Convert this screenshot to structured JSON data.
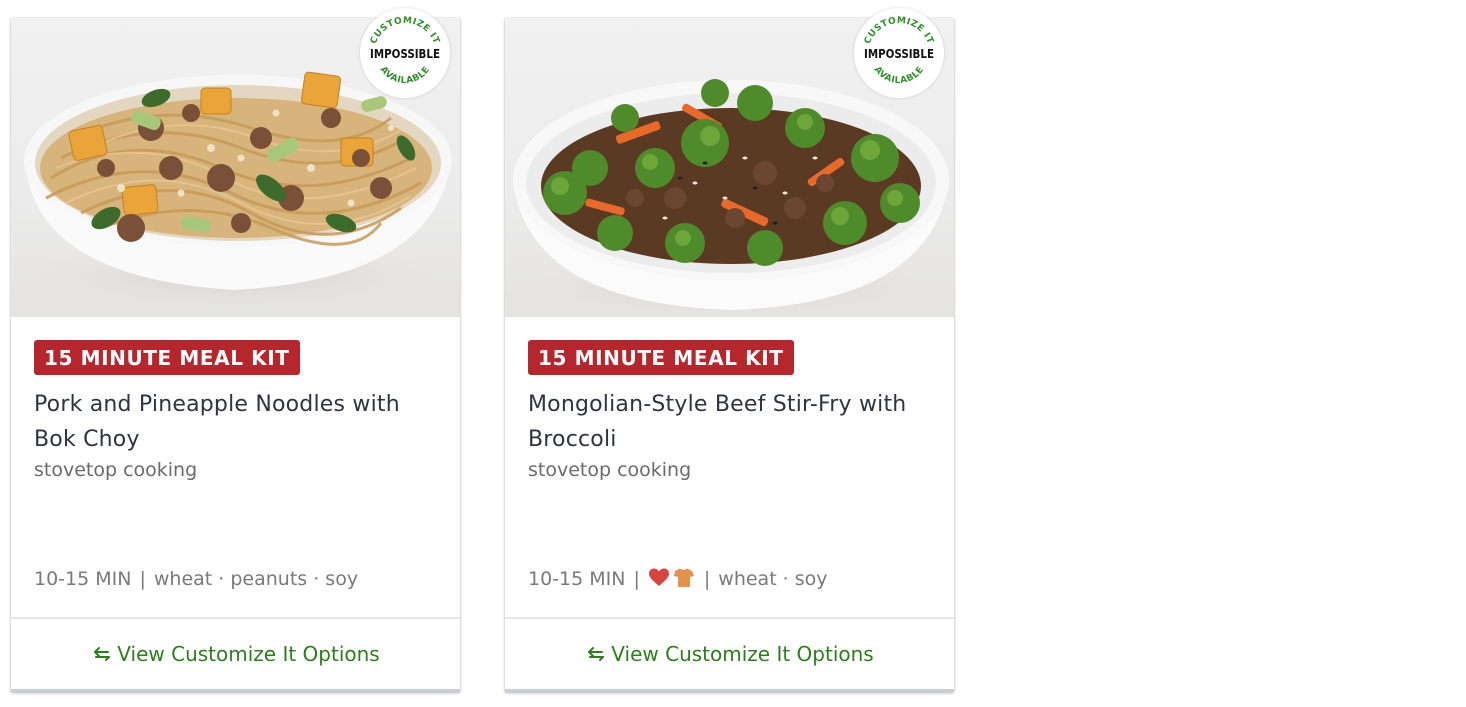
{
  "cards": [
    {
      "badge_top": "CUSTOMIZE IT",
      "badge_brand": "IMPOSSIBLE",
      "badge_bottom": "AVAILABLE",
      "tag": "15 MINUTE MEAL KIT",
      "title": "Pork and Pineapple Noodles with Bok Choy",
      "subtitle": "stovetop cooking",
      "time": "10-15 MIN",
      "allergens": "wheat · peanuts · soy",
      "action_label": "View Customize It Options",
      "action_icon": "swap-arrows-icon"
    },
    {
      "badge_top": "CUSTOMIZE IT",
      "badge_brand": "IMPOSSIBLE",
      "badge_bottom": "AVAILABLE",
      "tag": "15 MINUTE MEAL KIT",
      "title": "Mongolian-Style Beef Stir-Fry with Broccoli",
      "subtitle": "stovetop cooking",
      "time": "10-15 MIN",
      "diet_icons": [
        "heart-healthy-icon",
        "calorie-conscious-icon"
      ],
      "allergens": "wheat · soy",
      "action_label": "View Customize It Options",
      "action_icon": "swap-arrows-icon"
    }
  ],
  "colors": {
    "tag_bg": "#b5272d",
    "action_text": "#2e7d1e",
    "badge_green": "#2f8f2a",
    "heart": "#d8443f",
    "shirt": "#e3924b"
  }
}
